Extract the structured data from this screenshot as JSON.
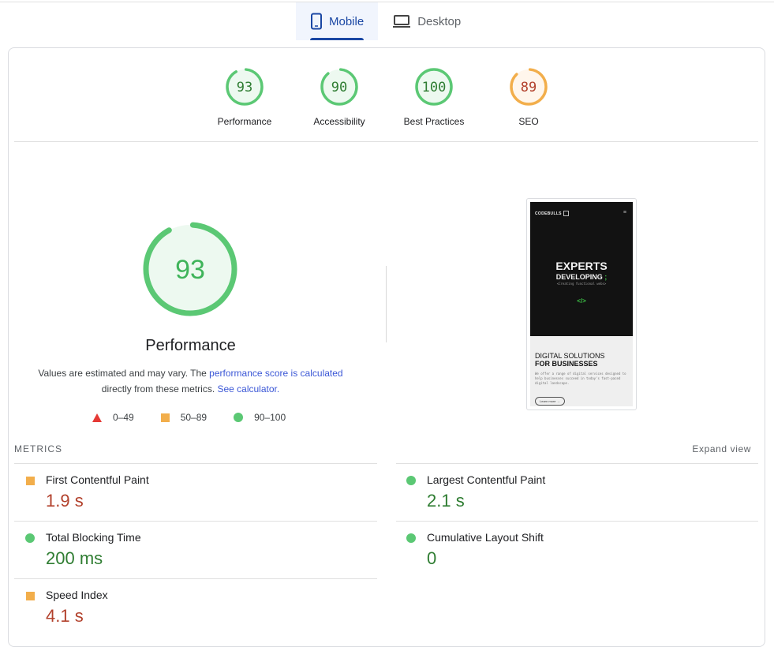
{
  "tabs": [
    {
      "label": "Mobile",
      "icon": "mobile-phone-icon",
      "active": true
    },
    {
      "label": "Desktop",
      "icon": "laptop-icon",
      "active": false
    }
  ],
  "colors": {
    "pass": "#5bc874",
    "average": "#f2ae4b",
    "fail": "#e53935",
    "pass_text": "#2f7d32",
    "average_text": "#b2412c",
    "link": "#3b57d6",
    "tab_active": "#1a47a4"
  },
  "categories": [
    {
      "label": "Performance",
      "score": 93,
      "rating": "pass"
    },
    {
      "label": "Accessibility",
      "score": 90,
      "rating": "pass"
    },
    {
      "label": "Best Practices",
      "score": 100,
      "rating": "pass"
    },
    {
      "label": "SEO",
      "score": 89,
      "rating": "average"
    }
  ],
  "performance": {
    "score": 93,
    "label": "Performance",
    "desc_prefix": "Values are estimated and may vary. The ",
    "desc_link1": "performance score is calculated",
    "desc_middle": "directly from these metrics. ",
    "desc_link2": "See calculator."
  },
  "legend": [
    {
      "shape": "triangle",
      "range": "0–49"
    },
    {
      "shape": "square",
      "range": "50–89"
    },
    {
      "shape": "circle",
      "range": "90–100"
    }
  ],
  "screenshot": {
    "brand": "CODEBULLS",
    "headline1": "EXPERTS",
    "headline2": "DEVELOPING",
    "semicolon": ";",
    "tagline": "<Creating functional webs>",
    "code_icon": "</>",
    "section_title1": "DIGITAL SOLUTIONS",
    "section_title2": "FOR BUSINESSES",
    "section_text": "We offer a range of digital services designed to help businesses succeed in today's fast-paced digital landscape.",
    "button": "Learn more →"
  },
  "metrics": {
    "heading": "METRICS",
    "expand_label": "Expand view",
    "items": [
      {
        "name": "First Contentful Paint",
        "value": "1.9 s",
        "rating": "average"
      },
      {
        "name": "Largest Contentful Paint",
        "value": "2.1 s",
        "rating": "pass"
      },
      {
        "name": "Total Blocking Time",
        "value": "200 ms",
        "rating": "pass"
      },
      {
        "name": "Cumulative Layout Shift",
        "value": "0",
        "rating": "pass"
      },
      {
        "name": "Speed Index",
        "value": "4.1 s",
        "rating": "average"
      }
    ]
  }
}
